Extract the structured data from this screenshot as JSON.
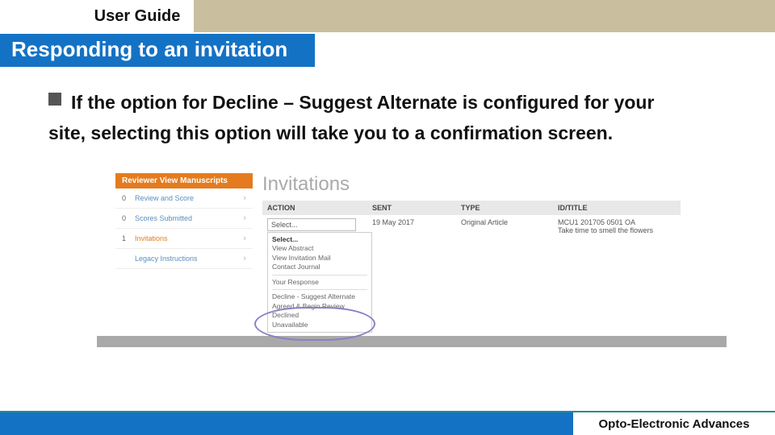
{
  "header": {
    "guide_label": "User Guide"
  },
  "section": {
    "title": "Responding to an invitation"
  },
  "body": {
    "line1": "If the option for Decline – Suggest Alternate is configured for your",
    "line2": "site, selecting this option will take you to a confirmation screen."
  },
  "screenshot": {
    "sidebar": {
      "header": "Reviewer View Manuscripts",
      "items": [
        {
          "count": "0",
          "label": "Review and Score"
        },
        {
          "count": "0",
          "label": "Scores Submitted"
        },
        {
          "count": "1",
          "label": "Invitations",
          "selected": true
        },
        {
          "count": "",
          "label": "Legacy Instructions"
        }
      ]
    },
    "main": {
      "title": "Invitations",
      "columns": {
        "action": "ACTION",
        "sent": "SENT",
        "type": "TYPE",
        "id": "ID/TITLE"
      },
      "row": {
        "select_label": "Select...",
        "sent": "19 May 2017",
        "type": "Original Article",
        "id_line1": "MCU1 201705 0501 OA",
        "id_line2": "Take time to smell the flowers"
      },
      "dropdown": {
        "top_label": "Select...",
        "opt1": "View Abstract",
        "opt2": "View Invitation Mail",
        "opt3": "Contact Journal",
        "group": "Your Response",
        "resp1": "Decline - Suggest Alternate",
        "resp2": "Agreed & Begin Review",
        "resp3": "Declined",
        "resp4": "Unavailable"
      }
    }
  },
  "footer": {
    "journal": "Opto-Electronic Advances"
  }
}
